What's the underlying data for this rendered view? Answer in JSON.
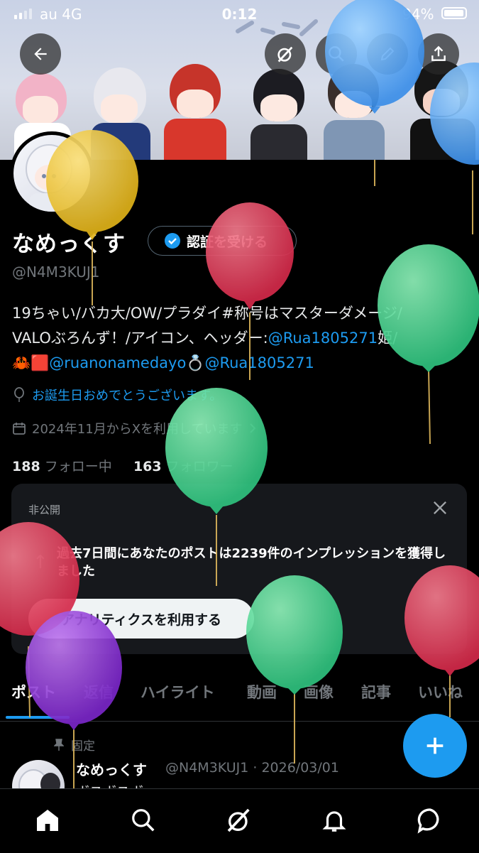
{
  "status_bar": {
    "carrier": "au  4G",
    "time": "0:12",
    "battery": "94%"
  },
  "header_icons": [
    "back-arrow-icon",
    "grok-icon",
    "search-icon",
    "edit-icon",
    "share-icon"
  ],
  "profile": {
    "name": "なめっくす",
    "verify_label": "認証を受ける",
    "handle": "@N4M3KUJ1",
    "bio_line1": "19ちゃい/バカ大/OW/プラダイ#称号はマスターダメージ/",
    "bio_line2_prefix": "VALOぶろんず！/アイコン、ヘッダー:",
    "bio_link1": "@Rua1805271",
    "bio_line2_suffix": "姫/",
    "bio_line3_emoji": "🦀🟥",
    "bio_link2": "@ruanonamedayo",
    "bio_ring": "💍",
    "bio_link3": "@Rua1805271",
    "birthday": "お誕生日おめでとうございます。",
    "joined": "2024年11月からXを利用しています",
    "following_count": "188",
    "following_label": "フォロー中",
    "followers_count": "163",
    "followers_label": "フォロワー"
  },
  "analytics_card": {
    "label": "非公開",
    "message": "過去7日間にあなたのポストは2239件のインプレッションを獲得しました",
    "button": "アナリティクスを利用する"
  },
  "tabs": [
    "ポスト",
    "返信",
    "ハイライト",
    "動画",
    "画像",
    "記事",
    "いいね"
  ],
  "pinned_post": {
    "pinned_label": "固定",
    "name": "なめっくす",
    "meta": "@N4M3KUJ1 · 2026/03/01",
    "text": "ボスボスボ..."
  },
  "nav_items": [
    "home-icon",
    "search-icon",
    "grok-icon",
    "notifications-icon",
    "messages-icon"
  ],
  "colors": {
    "accent": "#1d9bf0",
    "background": "#000000",
    "card": "#16181c"
  }
}
